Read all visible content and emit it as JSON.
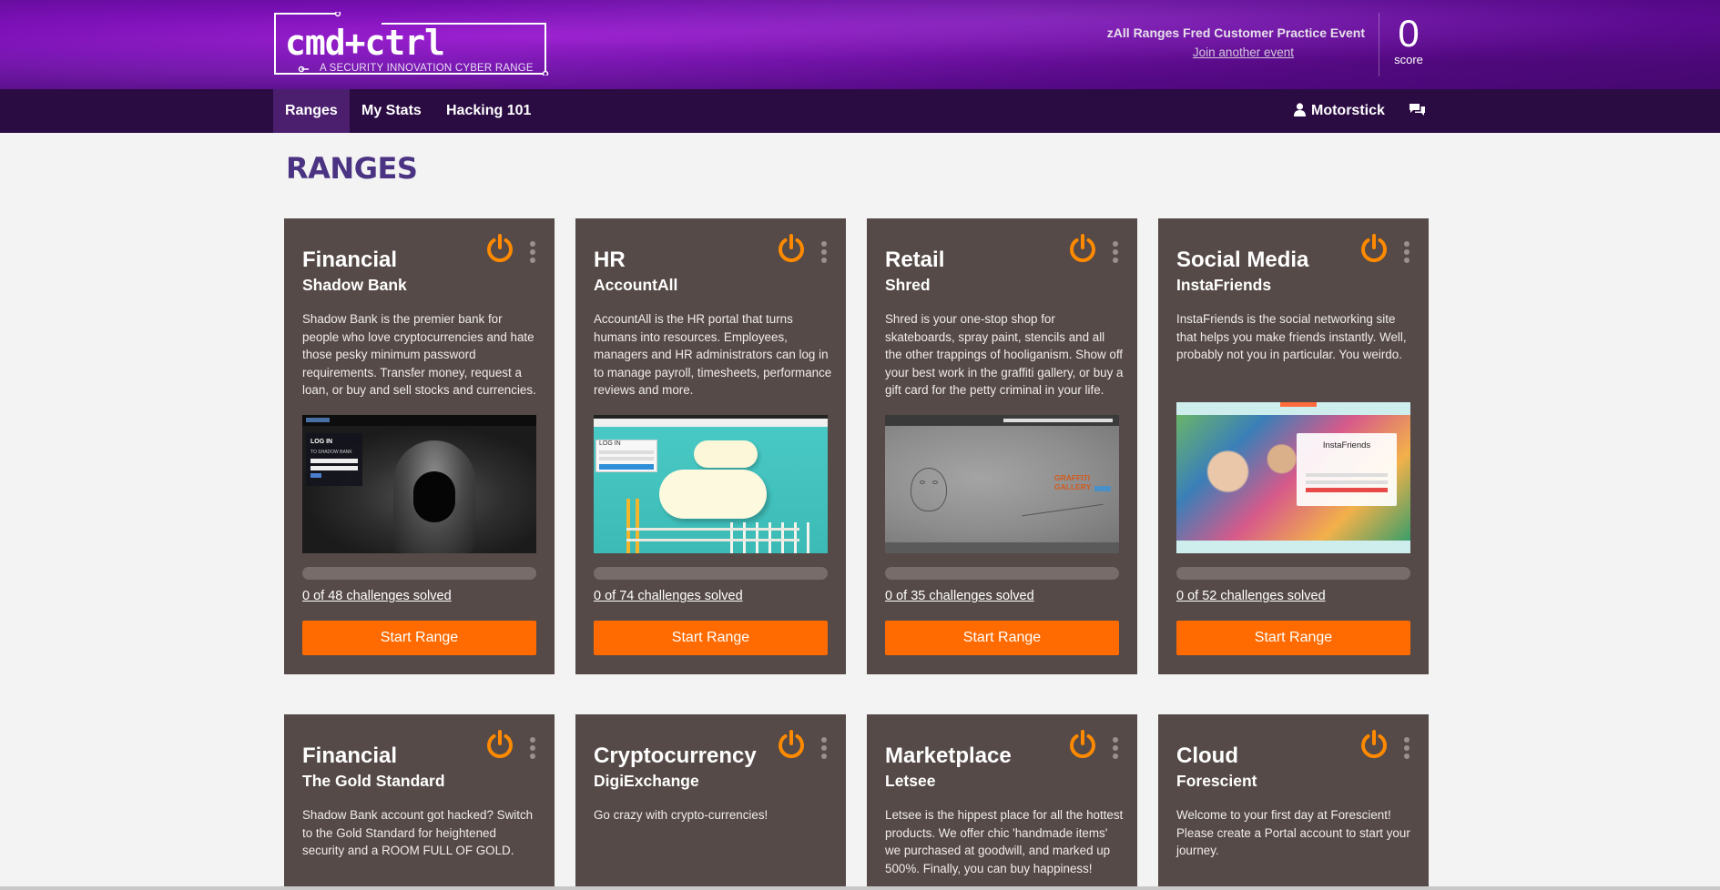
{
  "logo": {
    "wordmark": "cmd+ctrl",
    "tagline": "A SECURITY INNOVATION CYBER RANGE"
  },
  "event": {
    "name": "zAll Ranges Fred Customer Practice Event",
    "join_link": "Join another event"
  },
  "score": {
    "value": "0",
    "label": "score"
  },
  "nav": {
    "items": [
      "Ranges",
      "My Stats",
      "Hacking 101"
    ],
    "active": "Ranges",
    "user": "Motorstick"
  },
  "page_title": "RANGES",
  "cards": [
    {
      "title": "Financial",
      "subtitle": "Shadow Bank",
      "description": "Shadow Bank is the premier bank for people who love cryptocurrencies and hate those pesky minimum password requirements. Transfer money, request a loan, or buy and sell stocks and currencies.",
      "solved_text": "0 of 48 challenges solved",
      "progress": 0,
      "button": "Start Range"
    },
    {
      "title": "HR",
      "subtitle": "AccountAll",
      "description": "AccountAll is the HR portal that turns humans into resources. Employees, managers and HR administrators can log in to manage payroll, timesheets, performance reviews and more.",
      "solved_text": "0 of 74 challenges solved",
      "progress": 0,
      "button": "Start Range"
    },
    {
      "title": "Retail",
      "subtitle": "Shred",
      "description": "Shred is your one-stop shop for skateboards, spray paint, stencils and all the other trappings of hooliganism. Show off your best work in the graffiti gallery, or buy a gift card for the petty criminal in your life.",
      "solved_text": "0 of 35 challenges solved",
      "progress": 0,
      "button": "Start Range"
    },
    {
      "title": "Social Media",
      "subtitle": "InstaFriends",
      "description": "InstaFriends is the social networking site that helps you make friends instantly. Well, probably not you in particular. You weirdo.",
      "solved_text": "0 of 52 challenges solved",
      "progress": 0,
      "button": "Start Range"
    },
    {
      "title": "Financial",
      "subtitle": "The Gold Standard",
      "description": "Shadow Bank account got hacked? Switch to the Gold Standard for heightened security and a ROOM FULL OF GOLD."
    },
    {
      "title": "Cryptocurrency",
      "subtitle": "DigiExchange",
      "description": "Go crazy with crypto-currencies!"
    },
    {
      "title": "Marketplace",
      "subtitle": "Letsee",
      "description": "Letsee is the hippest place for all the hottest products. We offer chic 'handmade items' we purchased at goodwill, and marked up 500%. Finally, you can buy happiness!"
    },
    {
      "title": "Cloud",
      "subtitle": "Forescient",
      "description": "Welcome to your first day at Forescient! Please create a Portal account to start your journey."
    }
  ],
  "shots": {
    "shadow_bank": {
      "login_title": "LOG IN",
      "login_sub": "TO SHADOW BANK"
    },
    "accountall": {
      "login_title": "LOG IN"
    },
    "shred": {
      "brand": "GRAFFITI GALLERY"
    },
    "instafriends": {
      "brand": "InstaFriends"
    }
  },
  "colors": {
    "header": "#7a10b5",
    "nav": "#2a0b42",
    "card": "#554a47",
    "accent": "#ff6b00",
    "title": "#4a3382"
  }
}
